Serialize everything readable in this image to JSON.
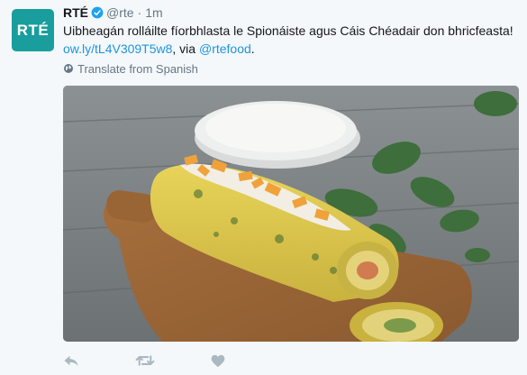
{
  "tweet": {
    "avatar_text": "RTÉ",
    "name": "RTÉ",
    "handle": "@rte",
    "separator": "·",
    "time": "1m",
    "text": "Uibheagán rolláilte fíorbhlasta le Spionáiste agus Cáis Chéadair don bhricfeasta!",
    "link": "ow.ly/tL4V309T5w8",
    "via": ", via ",
    "mention": "@rtefood",
    "period": ".",
    "translate": "Translate from Spanish"
  },
  "icons": {
    "verified": "verified-badge-icon",
    "globe": "globe-icon",
    "reply": "reply-icon",
    "retweet": "retweet-icon",
    "like": "heart-icon"
  },
  "colors": {
    "avatar_bg": "#1a9d9d",
    "link": "#1b95e0",
    "secondary_text": "#657786",
    "action_icon": "#aab8c2",
    "verified": "#1da1f2"
  }
}
